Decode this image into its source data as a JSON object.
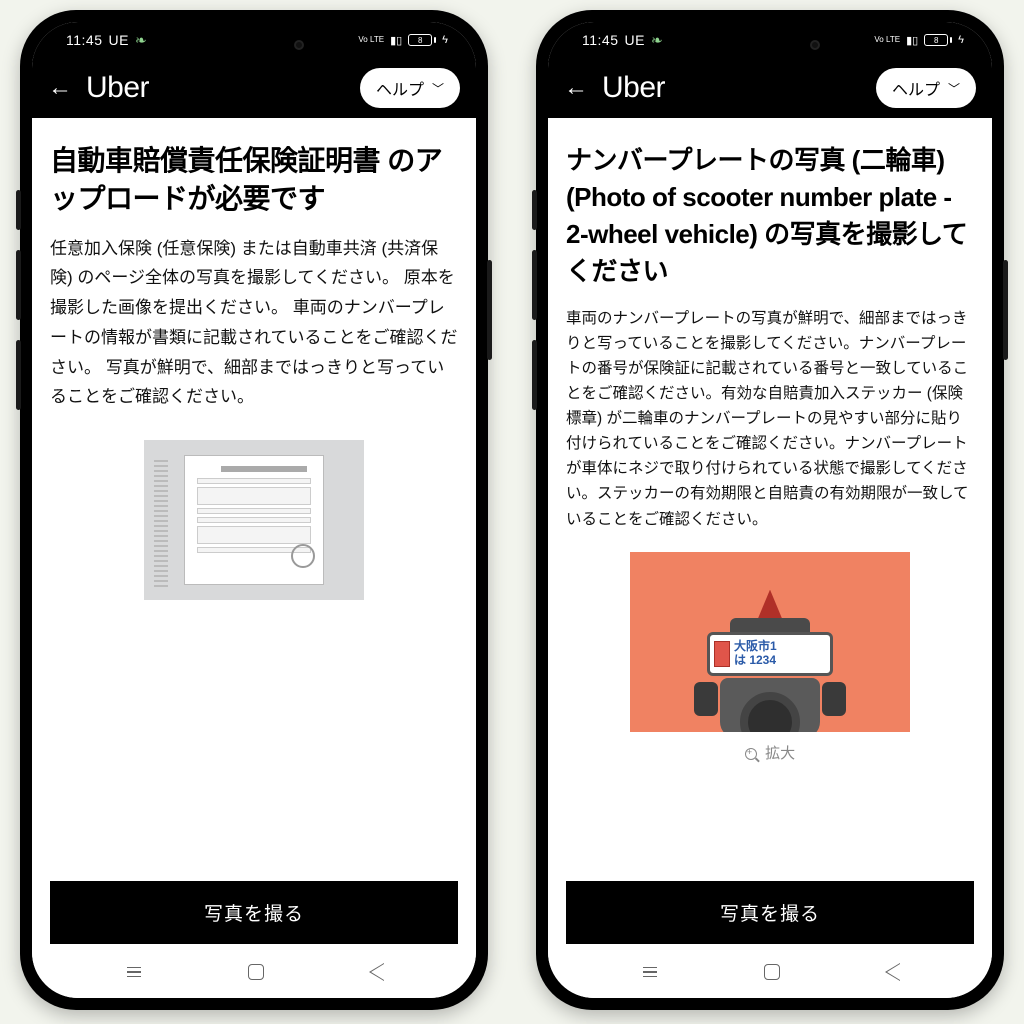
{
  "statusbar": {
    "time": "11:45",
    "carrier": "UE",
    "volte": "Vo LTE",
    "battery": "8"
  },
  "appbar": {
    "logo": "Uber",
    "help_label": "ヘルプ"
  },
  "left": {
    "title": "自動車賠償責任保険証明書 のアップロードが必要です",
    "desc": "任意加入保険 (任意保険) または自動車共済 (共済保険) のページ全体の写真を撮影してください。 原本を撮影した画像を提出ください。 車両のナンバープレートの情報が書類に記載されていることをご確認ください。 写真が鮮明で、細部まではっきりと写っていることをご確認ください。",
    "button": "写真を撮る"
  },
  "right": {
    "title": "ナンバープレートの写真 (二輪車) (Photo of scooter number plate - 2-wheel vehicle) の写真を撮影してください",
    "desc": "車両のナンバープレートの写真が鮮明で、細部まではっきりと写っていることを撮影してください。ナンバープレートの番号が保険証に記載されている番号と一致していることをご確認ください。有効な自賠責加入ステッカー (保険標章) が二輪車のナンバープレートの見やすい部分に貼り付けられていることをご確認ください。ナンバープレートが車体にネジで取り付けられている状態で撮影してください。ステッカーの有効期限と自賠責の有効期限が一致していることをご確認ください。",
    "plate_line1": "大阪市1",
    "plate_line2": "は 1234",
    "zoom_label": "拡大",
    "button": "写真を撮る"
  }
}
